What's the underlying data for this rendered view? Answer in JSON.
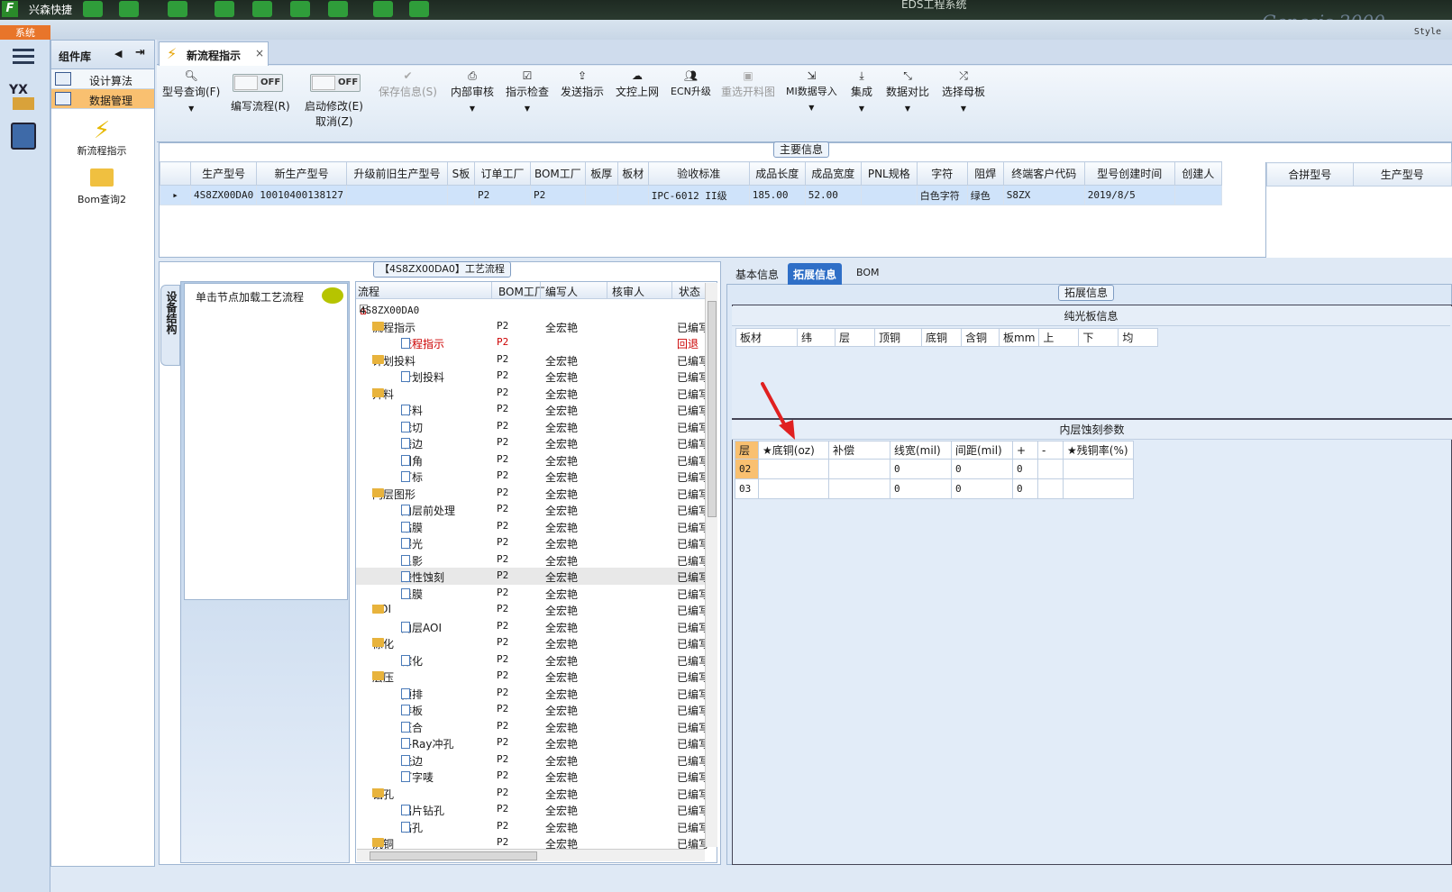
{
  "titlebar": {
    "app_name": "兴森快捷",
    "window_title": "EDS工程系统",
    "watermark": "Genesis 2000"
  },
  "menubar": {
    "system_tab": "系统",
    "style_label": "Style"
  },
  "component_panel": {
    "title": "组件库",
    "items": [
      {
        "label": "设计算法"
      },
      {
        "label": "数据管理"
      }
    ],
    "tools": [
      {
        "label": "新流程指示"
      },
      {
        "label": "Bom查询2"
      }
    ]
  },
  "doc_tab": {
    "label": "新流程指示"
  },
  "toolbar": {
    "model_query": "型号查询(F)",
    "edit_flow": "编写流程(R)",
    "start_modify": "启动修改(E)",
    "cancel": "取消(Z)",
    "off": "OFF",
    "save_info": "保存信息(S)",
    "internal_review": "内部审核",
    "indicator_check": "指示检查",
    "send_indicator": "发送指示",
    "doc_upload": "文控上网",
    "ecn_upgrade": "ECN升级",
    "reselect_image": "重选开料图",
    "mi_import": "MI数据导入",
    "integrate": "集成",
    "data_compare": "数据对比",
    "select_mother": "选择母板"
  },
  "main_info": {
    "title": "主要信息",
    "columns": [
      "生产型号",
      "新生产型号",
      "升级前旧生产型号",
      "S板",
      "订单工厂",
      "BOM工厂",
      "板厚",
      "板材",
      "验收标准",
      "成品长度",
      "成品宽度",
      "PNL规格",
      "字符",
      "阻焊",
      "终端客户代码",
      "型号创建时间",
      "创建人"
    ],
    "row": [
      "4S8ZX00DA0",
      "10010400138127",
      "",
      "",
      "P2",
      "P2",
      "",
      "",
      "IPC-6012 II级",
      "185.00",
      "52.00",
      "",
      "白色字符",
      "绿色",
      "S8ZX",
      "2019/8/5",
      ""
    ],
    "merge_columns": [
      "合拼型号",
      "生产型号"
    ]
  },
  "process": {
    "title": "【4S8ZX00DA0】工艺流程",
    "side_tab": "设备结构",
    "load_hint": "单击节点加载工艺流程",
    "columns": [
      "流程",
      "BOM工厂",
      "编写人",
      "核审人",
      "状态"
    ],
    "root": "4S8ZX00DA0",
    "rows": [
      {
        "name": "流程指示",
        "level": 1,
        "factory": "P2",
        "writer": "全宏艳",
        "status": "已编写"
      },
      {
        "name": "流程指示",
        "level": 2,
        "factory": "P2",
        "writer": "",
        "status": "回退",
        "red": true
      },
      {
        "name": "计划投料",
        "level": 1,
        "factory": "P2",
        "writer": "全宏艳",
        "status": "已编写"
      },
      {
        "name": "计划投料",
        "level": 2,
        "factory": "P2",
        "writer": "全宏艳",
        "status": "已编写"
      },
      {
        "name": "开料",
        "level": 1,
        "factory": "P2",
        "writer": "全宏艳",
        "status": "已编写"
      },
      {
        "name": "开料",
        "level": 2,
        "factory": "P2",
        "writer": "全宏艳",
        "status": "已编写"
      },
      {
        "name": "裁切",
        "level": 2,
        "factory": "P2",
        "writer": "全宏艳",
        "status": "已编写"
      },
      {
        "name": "磨边",
        "level": 2,
        "factory": "P2",
        "writer": "全宏艳",
        "status": "已编写"
      },
      {
        "name": "圆角",
        "level": 2,
        "factory": "P2",
        "writer": "全宏艳",
        "status": "已编写"
      },
      {
        "name": "打标",
        "level": 2,
        "factory": "P2",
        "writer": "全宏艳",
        "status": "已编写"
      },
      {
        "name": "内层图形",
        "level": 1,
        "factory": "P2",
        "writer": "全宏艳",
        "status": "已编写"
      },
      {
        "name": "内层前处理",
        "level": 2,
        "factory": "P2",
        "writer": "全宏艳",
        "status": "已编写"
      },
      {
        "name": "贴膜",
        "level": 2,
        "factory": "P2",
        "writer": "全宏艳",
        "status": "已编写"
      },
      {
        "name": "曝光",
        "level": 2,
        "factory": "P2",
        "writer": "全宏艳",
        "status": "已编写"
      },
      {
        "name": "显影",
        "level": 2,
        "factory": "P2",
        "writer": "全宏艳",
        "status": "已编写"
      },
      {
        "name": "酸性蚀刻",
        "level": 2,
        "factory": "P2",
        "writer": "全宏艳",
        "status": "已编写",
        "hl": true
      },
      {
        "name": "退膜",
        "level": 2,
        "factory": "P2",
        "writer": "全宏艳",
        "status": "已编写"
      },
      {
        "name": "AOI",
        "level": 1,
        "factory": "P2",
        "writer": "全宏艳",
        "status": "已编写"
      },
      {
        "name": "内层AOI",
        "level": 2,
        "factory": "P2",
        "writer": "全宏艳",
        "status": "已编写"
      },
      {
        "name": "棕化",
        "level": 1,
        "factory": "P2",
        "writer": "全宏艳",
        "status": "已编写"
      },
      {
        "name": "棕化",
        "level": 2,
        "factory": "P2",
        "writer": "全宏艳",
        "status": "已编写"
      },
      {
        "name": "层压",
        "level": 1,
        "factory": "P2",
        "writer": "全宏艳",
        "status": "已编写"
      },
      {
        "name": "预排",
        "level": 2,
        "factory": "P2",
        "writer": "全宏艳",
        "status": "已编写"
      },
      {
        "name": "排板",
        "level": 2,
        "factory": "P2",
        "writer": "全宏艳",
        "status": "已编写"
      },
      {
        "name": "压合",
        "level": 2,
        "factory": "P2",
        "writer": "全宏艳",
        "status": "已编写"
      },
      {
        "name": "X-Ray冲孔",
        "level": 2,
        "factory": "P2",
        "writer": "全宏艳",
        "status": "已编写"
      },
      {
        "name": "铣边",
        "level": 2,
        "factory": "P2",
        "writer": "全宏艳",
        "status": "已编写"
      },
      {
        "name": "打字唛",
        "level": 2,
        "factory": "P2",
        "writer": "全宏艳",
        "status": "已编写"
      },
      {
        "name": "钻孔",
        "level": 1,
        "factory": "P2",
        "writer": "全宏艳",
        "status": "已编写"
      },
      {
        "name": "铝片钻孔",
        "level": 2,
        "factory": "P2",
        "writer": "全宏艳",
        "status": "已编写"
      },
      {
        "name": "钻孔",
        "level": 2,
        "factory": "P2",
        "writer": "全宏艳",
        "status": "已编写"
      },
      {
        "name": "沉铜",
        "level": 1,
        "factory": "P2",
        "writer": "全宏艳",
        "status": "已编写"
      }
    ]
  },
  "right": {
    "tabs": [
      "基本信息",
      "拓展信息",
      "BOM"
    ],
    "ext_title": "拓展信息",
    "pure_board": {
      "title": "纯光板信息",
      "columns": [
        "板材",
        "纬",
        "层",
        "顶铜",
        "底铜",
        "含铜",
        "板mm",
        "上",
        "下",
        "均"
      ]
    },
    "inner_etch": {
      "title": "内层蚀刻参数",
      "columns": [
        "层",
        "★底铜(oz)",
        "补偿",
        "线宽(mil)",
        "间距(mil)",
        "+",
        "-",
        "★残铜率(%)"
      ],
      "rows": [
        [
          "02",
          "",
          "",
          "0",
          "0",
          "0",
          "",
          ""
        ],
        [
          "03",
          "",
          "",
          "0",
          "0",
          "0",
          "",
          ""
        ]
      ]
    }
  }
}
